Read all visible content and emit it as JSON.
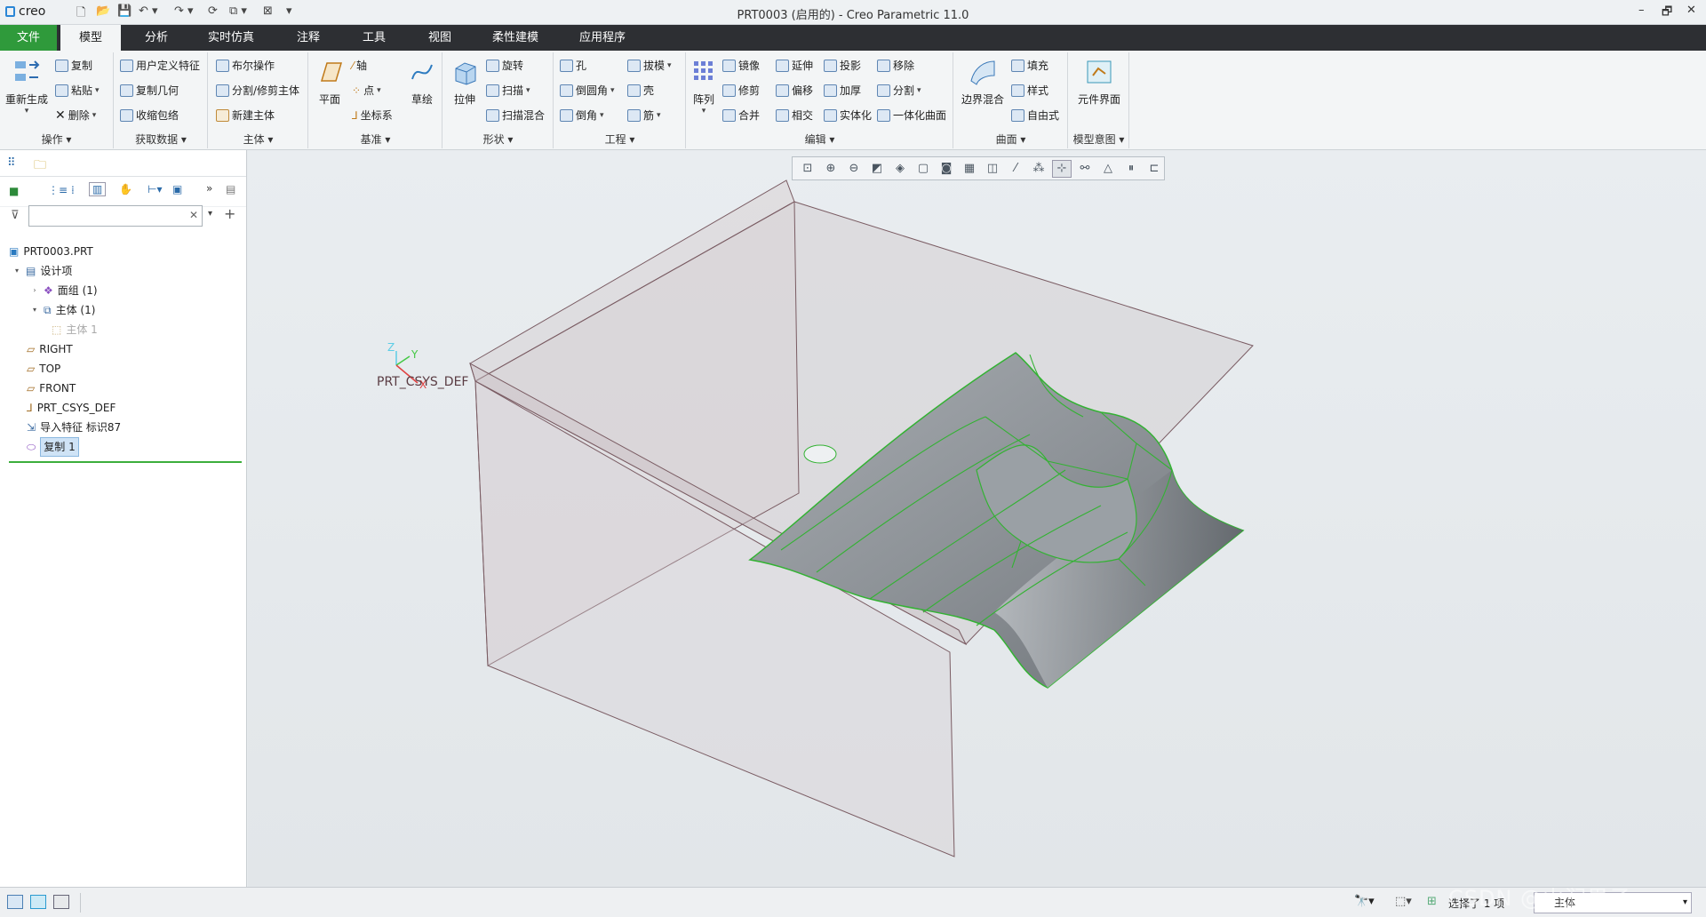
{
  "window": {
    "app_logo": "creo",
    "title": "PRT0003 (启用的) - Creo Parametric 11.0",
    "minimize": "–",
    "restore": "🗗",
    "close": "✕"
  },
  "quick_access": [
    "new-icon",
    "open-icon",
    "save-icon",
    "undo-icon",
    "redo-icon",
    "regenerate-icon",
    "window-icon",
    "close-window-icon",
    "customize-icon"
  ],
  "tabs": [
    {
      "label": "文件"
    },
    {
      "label": "模型"
    },
    {
      "label": "分析"
    },
    {
      "label": "实时仿真"
    },
    {
      "label": "注释"
    },
    {
      "label": "工具"
    },
    {
      "label": "视图"
    },
    {
      "label": "柔性建模"
    },
    {
      "label": "应用程序"
    }
  ],
  "ribbon": {
    "groups": [
      {
        "label": "操作",
        "big": "重新生成",
        "items": [
          "复制",
          "粘贴",
          "删除"
        ]
      },
      {
        "label": "获取数据",
        "items": [
          "用户定义特征",
          "复制几何",
          "收缩包络"
        ]
      },
      {
        "label": "主体",
        "items": [
          "布尔操作",
          "分割/修剪主体",
          "新建主体"
        ]
      },
      {
        "label": "基准",
        "big": "平面",
        "big2": "草绘",
        "items": [
          "轴",
          "点",
          "坐标系"
        ]
      },
      {
        "label": "形状",
        "big": "拉伸",
        "items": [
          "旋转",
          "扫描",
          "扫描混合"
        ]
      },
      {
        "label": "工程",
        "items": [
          "孔",
          "倒圆角",
          "倒角",
          "拔模",
          "壳",
          "筋"
        ]
      },
      {
        "label": "编辑",
        "big": "阵列",
        "items": [
          "镜像",
          "修剪",
          "合并",
          "延伸",
          "偏移",
          "相交",
          "投影",
          "加厚",
          "实体化",
          "移除",
          "分割",
          "一体化曲面"
        ]
      },
      {
        "label": "曲面",
        "big": "边界混合",
        "items": [
          "填充",
          "样式",
          "自由式"
        ]
      },
      {
        "label": "模型意图",
        "big": "元件界面"
      }
    ]
  },
  "model_tree": {
    "filter_placeholder": "",
    "nodes": [
      {
        "label": "PRT0003.PRT"
      },
      {
        "label": "设计项"
      },
      {
        "label": "面组 (1)"
      },
      {
        "label": "主体 (1)"
      },
      {
        "label": "主体 1"
      },
      {
        "label": "RIGHT"
      },
      {
        "label": "TOP"
      },
      {
        "label": "FRONT"
      },
      {
        "label": "PRT_CSYS_DEF"
      },
      {
        "label": "导入特征 标识87"
      },
      {
        "label": "复制 1"
      }
    ]
  },
  "viewport": {
    "csys_label": "PRT_CSYS_DEF",
    "axis_x": "X",
    "axis_y": "Y",
    "axis_z": "Z"
  },
  "statusbar": {
    "selection": "选择了 1 项",
    "filter_value": "主体",
    "watermark": "CSDN @山涧果子"
  }
}
